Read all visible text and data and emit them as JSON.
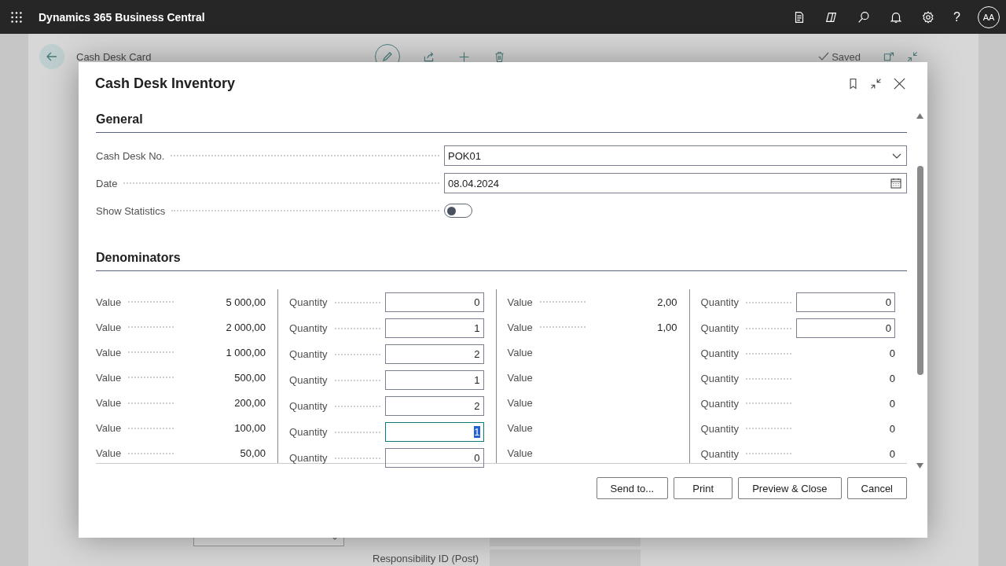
{
  "app": {
    "title": "Dynamics 365 Business Central",
    "help": "?",
    "avatar": "AA"
  },
  "page": {
    "title": "Cash Desk Card",
    "status": "Saved",
    "fields": [
      {
        "kind": "dropdown"
      },
      {
        "kind": "text"
      },
      {
        "label": "Responsibility ID (Post)",
        "kind": "text"
      }
    ]
  },
  "dialog": {
    "title": "Cash Desk Inventory",
    "general": {
      "heading": "General",
      "fields": [
        {
          "label": "Cash Desk No.",
          "kind": "dropdown",
          "value": "POK01"
        },
        {
          "label": "Date",
          "kind": "date",
          "value": "08.04.2024"
        },
        {
          "label": "Show Statistics",
          "kind": "toggle",
          "on": false
        }
      ]
    },
    "denominators": {
      "heading": "Denominators",
      "columns": [
        {
          "rows": [
            {
              "label": "Value",
              "kind": "text",
              "value": "5 000,00"
            },
            {
              "label": "Value",
              "kind": "text",
              "value": "2 000,00"
            },
            {
              "label": "Value",
              "kind": "text",
              "value": "1 000,00"
            },
            {
              "label": "Value",
              "kind": "text",
              "value": "500,00"
            },
            {
              "label": "Value",
              "kind": "text",
              "value": "200,00"
            },
            {
              "label": "Value",
              "kind": "text",
              "value": "100,00"
            },
            {
              "label": "Value",
              "kind": "text",
              "value": "50,00"
            }
          ]
        },
        {
          "rows": [
            {
              "label": "Quantity",
              "kind": "input",
              "value": "0",
              "focused": false
            },
            {
              "label": "Quantity",
              "kind": "input",
              "value": "1",
              "focused": false
            },
            {
              "label": "Quantity",
              "kind": "input",
              "value": "2",
              "focused": false
            },
            {
              "label": "Quantity",
              "kind": "input",
              "value": "1",
              "focused": false
            },
            {
              "label": "Quantity",
              "kind": "input",
              "value": "2",
              "focused": false
            },
            {
              "label": "Quantity",
              "kind": "input",
              "value": "1",
              "focused": true
            },
            {
              "label": "Quantity",
              "kind": "input",
              "value": "0",
              "focused": false
            }
          ]
        },
        {
          "rows": [
            {
              "label": "Value",
              "kind": "text",
              "value": "2,00"
            },
            {
              "label": "Value",
              "kind": "text",
              "value": "1,00"
            },
            {
              "label": "Value",
              "kind": "empty"
            },
            {
              "label": "Value",
              "kind": "empty"
            },
            {
              "label": "Value",
              "kind": "empty"
            },
            {
              "label": "Value",
              "kind": "empty"
            },
            {
              "label": "Value",
              "kind": "empty"
            }
          ]
        },
        {
          "rows": [
            {
              "label": "Quantity",
              "kind": "input",
              "value": "0",
              "focused": false
            },
            {
              "label": "Quantity",
              "kind": "input",
              "value": "0",
              "focused": false
            },
            {
              "label": "Quantity",
              "kind": "text",
              "value": "0"
            },
            {
              "label": "Quantity",
              "kind": "text",
              "value": "0"
            },
            {
              "label": "Quantity",
              "kind": "text",
              "value": "0"
            },
            {
              "label": "Quantity",
              "kind": "text",
              "value": "0"
            },
            {
              "label": "Quantity",
              "kind": "text",
              "value": "0"
            }
          ]
        }
      ]
    },
    "buttons": [
      "Send to...",
      "Print",
      "Preview & Close",
      "Cancel"
    ]
  }
}
